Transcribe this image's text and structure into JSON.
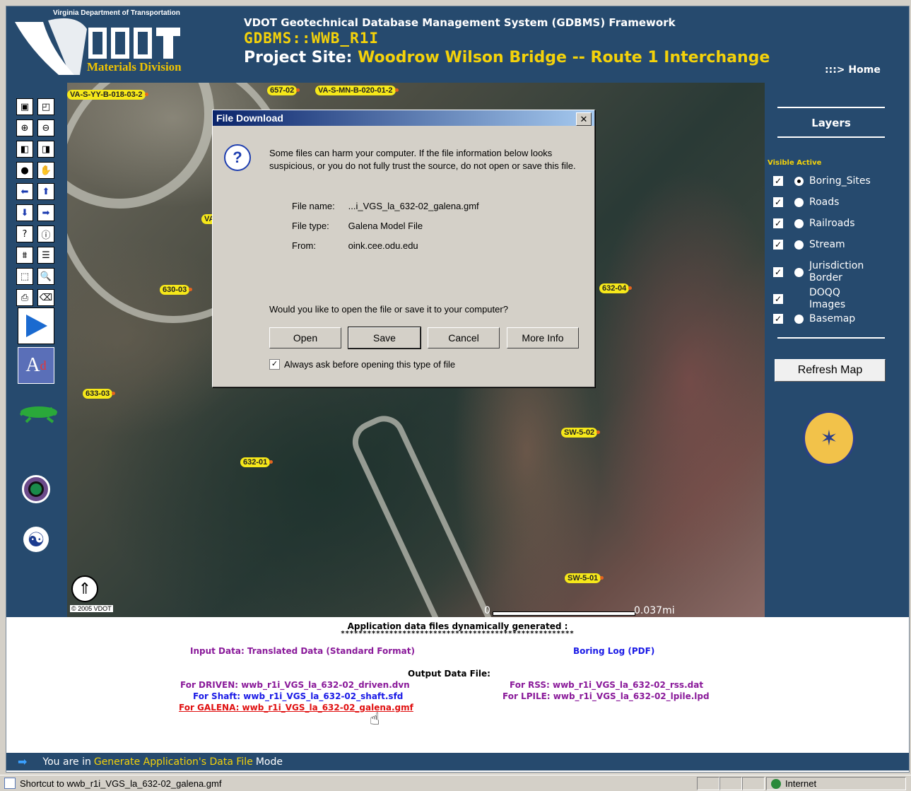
{
  "header": {
    "dept": "Virginia Department of Transportation",
    "logo_text": "VDOT",
    "division": "Materials Division",
    "framework": "VDOT Geotechnical Database Management System (GDBMS) Framework",
    "gdbms": "GDBMS::WWB_R1I",
    "site_label": "Project Site:",
    "site_name": "Woodrow Wilson Bridge -- Route 1 Interchange",
    "home_link": ":::> Home"
  },
  "map": {
    "labels": [
      "VA-S-YY-B-018-03-2",
      "657-02",
      "VA-S-MN-B-020-01-2",
      "630-03",
      "632-04",
      "633-03",
      "632-01",
      "SW-5-02",
      "SW-5-01",
      "VA"
    ],
    "copyright": "© 2005 VDOT",
    "scale_start": "0",
    "scale_end": "0.037mi"
  },
  "layers": {
    "title": "Layers",
    "header": "Visible Active",
    "items": [
      {
        "name": "Boring_Sites",
        "visible": true,
        "active": true
      },
      {
        "name": "Roads",
        "visible": true,
        "active": false
      },
      {
        "name": "Railroads",
        "visible": true,
        "active": false
      },
      {
        "name": "Stream",
        "visible": true,
        "active": false
      },
      {
        "name": "Jurisdiction Border",
        "visible": true,
        "active": false
      },
      {
        "name": "DOQQ Images",
        "visible": true,
        "active": null
      },
      {
        "name": "Basemap",
        "visible": true,
        "active": false
      }
    ],
    "refresh_label": "Refresh Map"
  },
  "dialog": {
    "title": "File Download",
    "warning": "Some files can harm your computer. If the file information below looks suspicious, or you do not fully trust the source, do not open or save this file.",
    "file_name_label": "File name:",
    "file_name": "...i_VGS_la_632-02_galena.gmf",
    "file_type_label": "File type:",
    "file_type": "Galena Model File",
    "from_label": "From:",
    "from": "oink.cee.odu.edu",
    "question": "Would you like to open the file or save it to your computer?",
    "open_label": "Open",
    "save_label": "Save",
    "cancel_label": "Cancel",
    "more_info_label": "More Info",
    "always_ask": "Always ask before opening this type of file",
    "always_ask_checked": true
  },
  "files": {
    "title": "Application data files dynamically generated :",
    "dots": "*****************************************************",
    "input_data": "Input Data: Translated Data (Standard Format)",
    "boring_log": "Boring Log (PDF)",
    "output_title": "Output Data File:",
    "driven": "For DRIVEN: wwb_r1i_VGS_la_632-02_driven.dvn",
    "shaft": "For Shaft: wwb_r1i_VGS_la_632-02_shaft.sfd",
    "galena": "For GALENA: wwb_r1i_VGS_la_632-02_galena.gmf",
    "rss": "For RSS: wwb_r1i_VGS_la_632-02_rss.dat",
    "lpile": "For LPILE: wwb_r1i_VGS_la_632-02_lpile.lpd"
  },
  "mode": {
    "prefix": "You are in",
    "mode_name": "Generate Application's Data File",
    "suffix": "Mode"
  },
  "status": {
    "text": "Shortcut to wwb_r1i_VGS_la_632-02_galena.gmf",
    "zone": "Internet"
  },
  "colors": {
    "panel_blue": "#264a6e",
    "accent_yellow": "#f4d20a"
  }
}
